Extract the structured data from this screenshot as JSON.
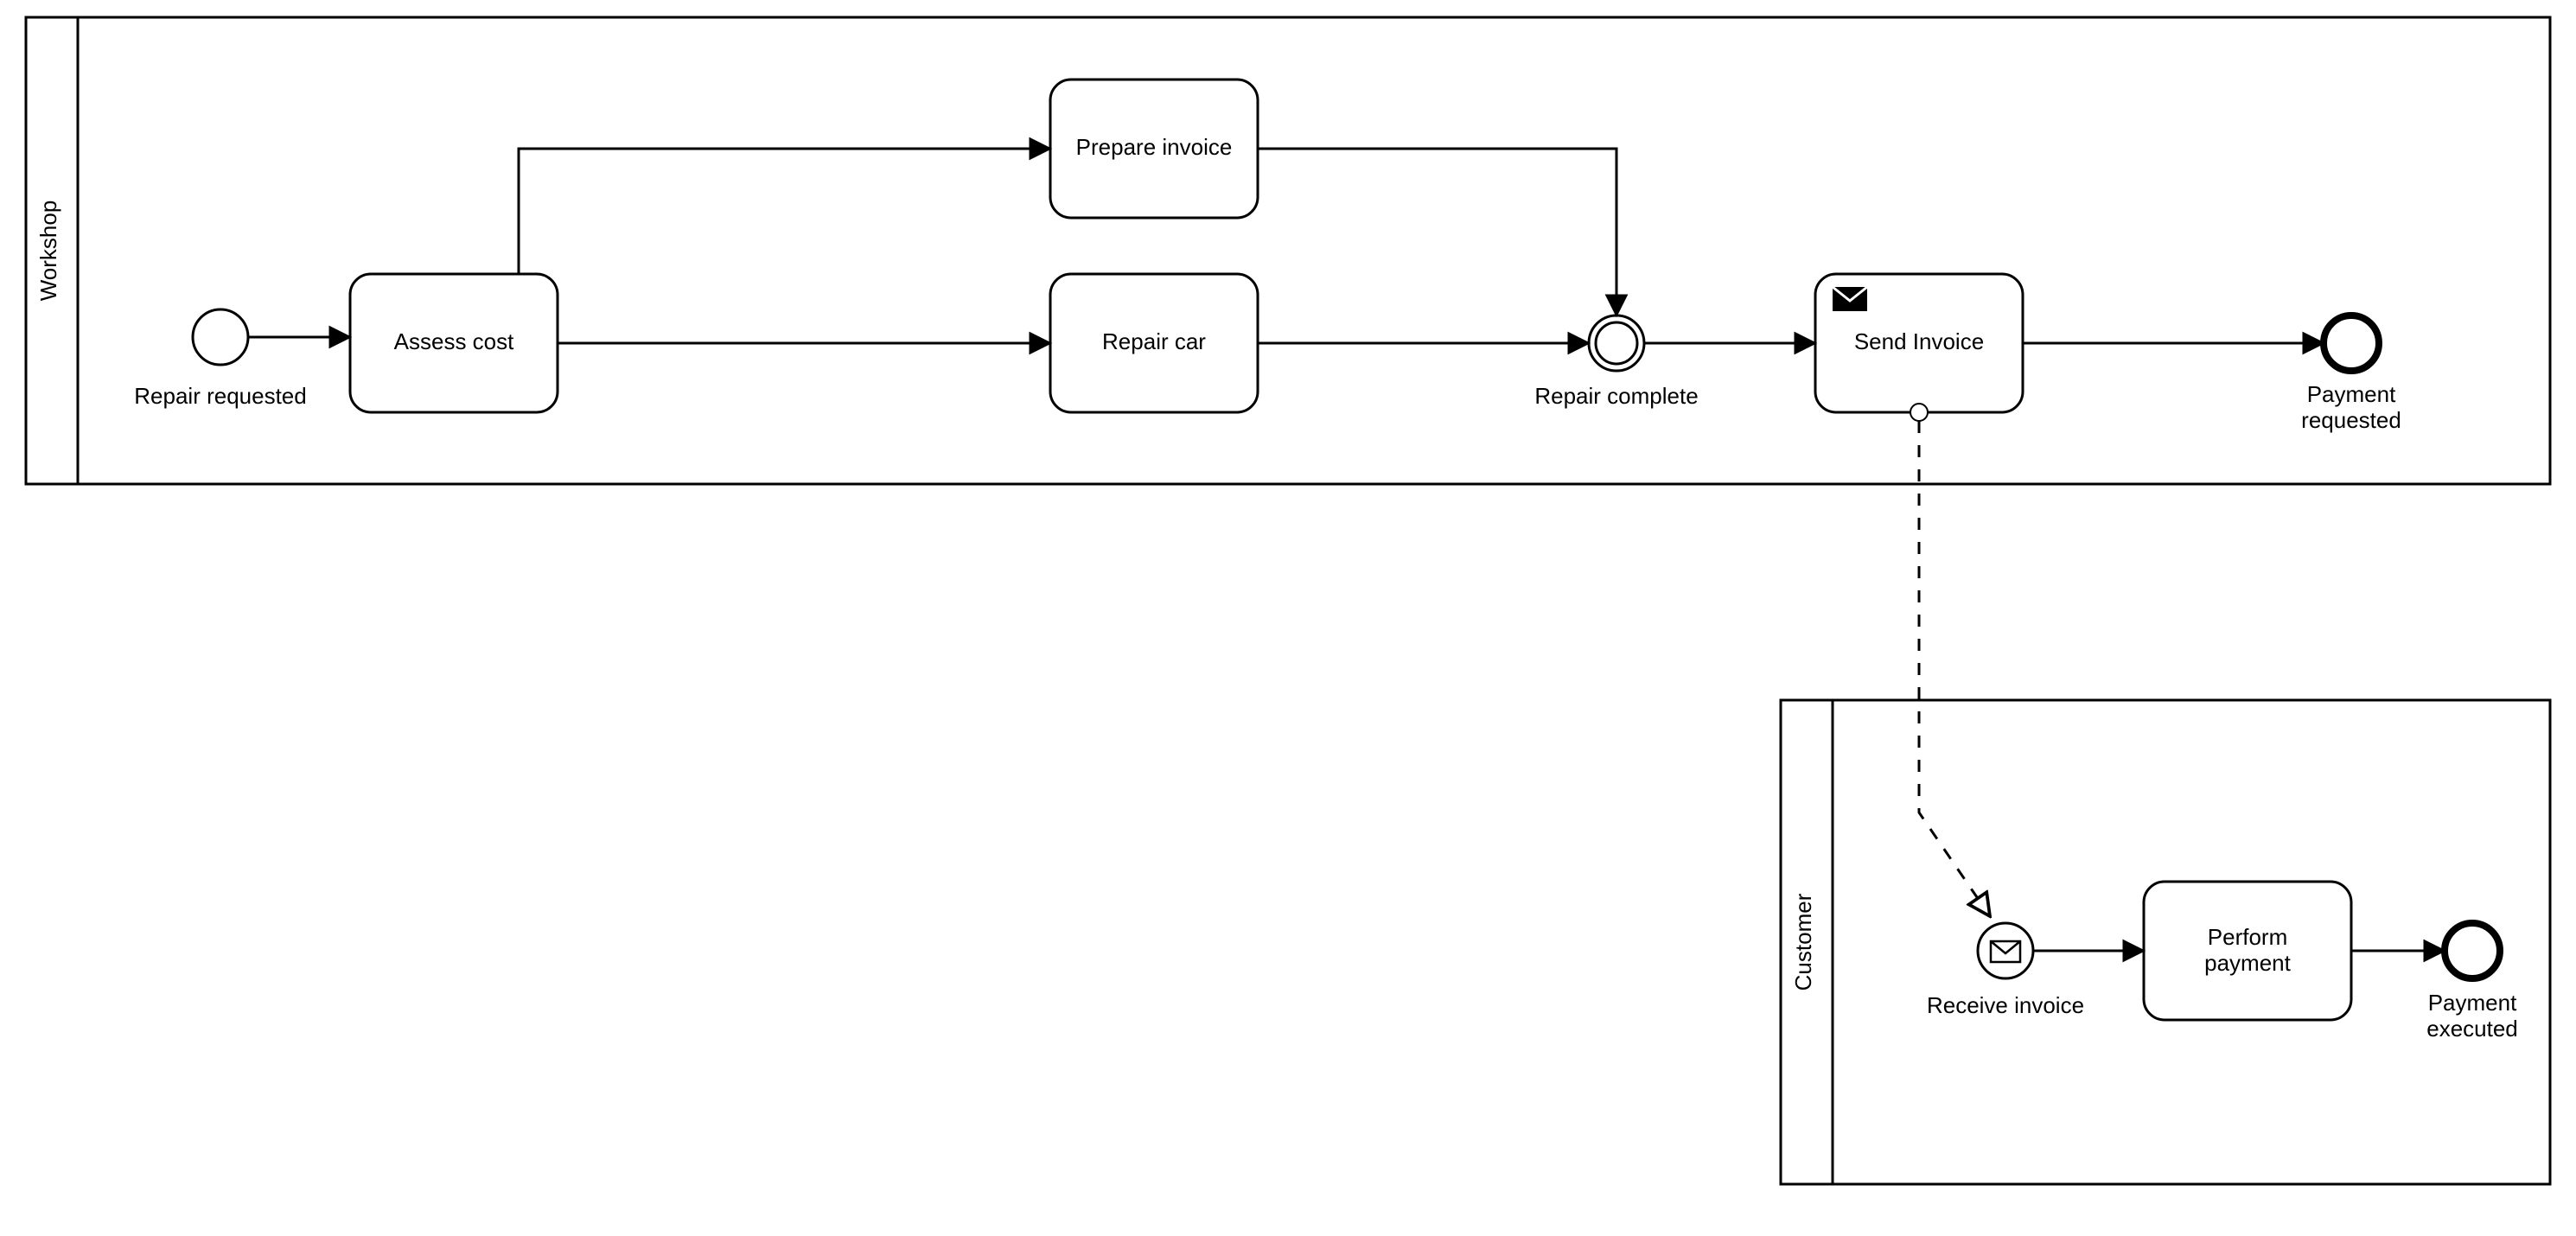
{
  "pools": {
    "workshop": {
      "label": "Workshop"
    },
    "customer": {
      "label": "Customer"
    }
  },
  "nodes": {
    "start1": {
      "label": "Repair requested"
    },
    "assess": {
      "label": "Assess cost"
    },
    "prepare_invoice": {
      "label": "Prepare invoice"
    },
    "repair_car": {
      "label": "Repair car"
    },
    "repair_complete": {
      "label": "Repair complete"
    },
    "send_invoice": {
      "label": "Send Invoice"
    },
    "payment_requested_l1": {
      "label": "Payment"
    },
    "payment_requested_l2": {
      "label": "requested"
    },
    "receive_invoice": {
      "label": "Receive invoice"
    },
    "perform_payment_l1": {
      "label": "Perform"
    },
    "perform_payment_l2": {
      "label": "payment"
    },
    "payment_executed_l1": {
      "label": "Payment"
    },
    "payment_executed_l2": {
      "label": "executed"
    }
  }
}
